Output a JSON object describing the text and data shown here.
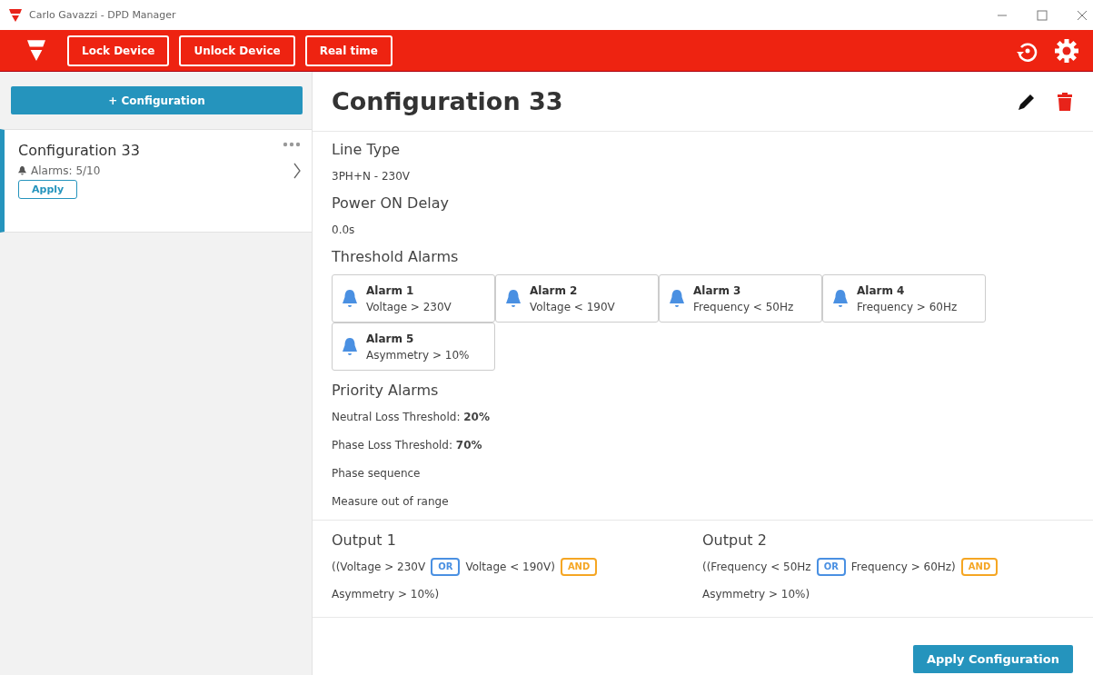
{
  "window": {
    "title": "Carlo Gavazzi - DPD Manager"
  },
  "toolbar": {
    "buttons": [
      "Lock Device",
      "Unlock Device",
      "Real time"
    ]
  },
  "sidebar": {
    "add_button": "+ Configuration",
    "items": [
      {
        "title": "Configuration 33",
        "alarms": "Alarms: 5/10",
        "apply": "Apply",
        "selected": true
      }
    ]
  },
  "detail": {
    "title": "Configuration 33",
    "sections": [
      {
        "heading": "Line Type",
        "lines": [
          "3PH+N - 230V"
        ]
      },
      {
        "heading": "Power ON Delay",
        "lines": [
          "0.0s"
        ]
      }
    ],
    "threshold_heading": "Threshold Alarms",
    "alarms": [
      {
        "name": "Alarm 1",
        "condition": "Voltage > 230V"
      },
      {
        "name": "Alarm 2",
        "condition": "Voltage < 190V"
      },
      {
        "name": "Alarm 3",
        "condition": "Frequency < 50Hz"
      },
      {
        "name": "Alarm 4",
        "condition": "Frequency > 60Hz"
      },
      {
        "name": "Alarm 5",
        "condition": "Asymmetry > 10%"
      }
    ],
    "priority_heading": "Priority Alarms",
    "priority_lines": [
      "Neutral Loss Threshold: **20%**",
      "Phase Loss Threshold: **70%**",
      "Phase sequence",
      "Measure out of range"
    ],
    "outputs": [
      {
        "title": "Output 1",
        "tokens": [
          {
            "kind": "text",
            "text": "((Voltage > 230V"
          },
          {
            "kind": "or",
            "text": "OR"
          },
          {
            "kind": "text",
            "text": "Voltage < 190V)"
          },
          {
            "kind": "and",
            "text": "AND"
          },
          {
            "kind": "text",
            "text": "Asymmetry > 10%)"
          }
        ]
      },
      {
        "title": "Output 2",
        "tokens": [
          {
            "kind": "text",
            "text": "((Frequency < 50Hz"
          },
          {
            "kind": "or",
            "text": "OR"
          },
          {
            "kind": "text",
            "text": "Frequency > 60Hz)"
          },
          {
            "kind": "and",
            "text": "AND"
          },
          {
            "kind": "text",
            "text": "Asymmetry > 10%)"
          }
        ]
      }
    ],
    "apply_button": "Apply Configuration"
  }
}
